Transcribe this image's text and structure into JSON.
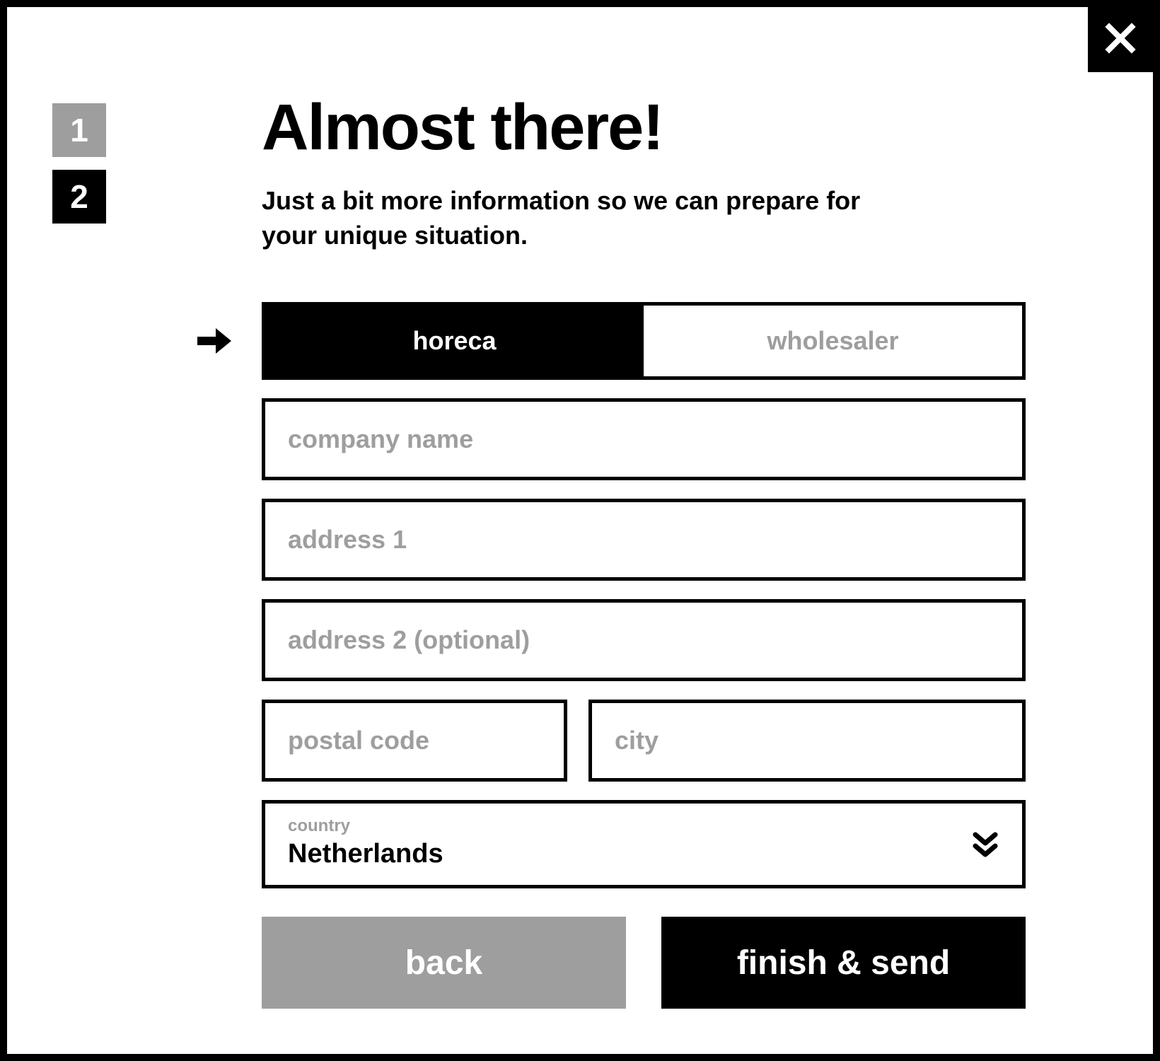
{
  "steps": {
    "one": "1",
    "two": "2"
  },
  "header": {
    "title": "Almost there!",
    "subtitle": "Just a bit more information so we can prepare for your unique situation."
  },
  "tabs": {
    "horeca": "horeca",
    "wholesaler": "wholesaler"
  },
  "fields": {
    "company_placeholder": "company name",
    "address1_placeholder": "address 1",
    "address2_placeholder": "address 2 (optional)",
    "postal_placeholder": "postal code",
    "city_placeholder": "city",
    "country_label": "country",
    "country_value": "Netherlands"
  },
  "buttons": {
    "back": "back",
    "finish": "finish & send"
  }
}
